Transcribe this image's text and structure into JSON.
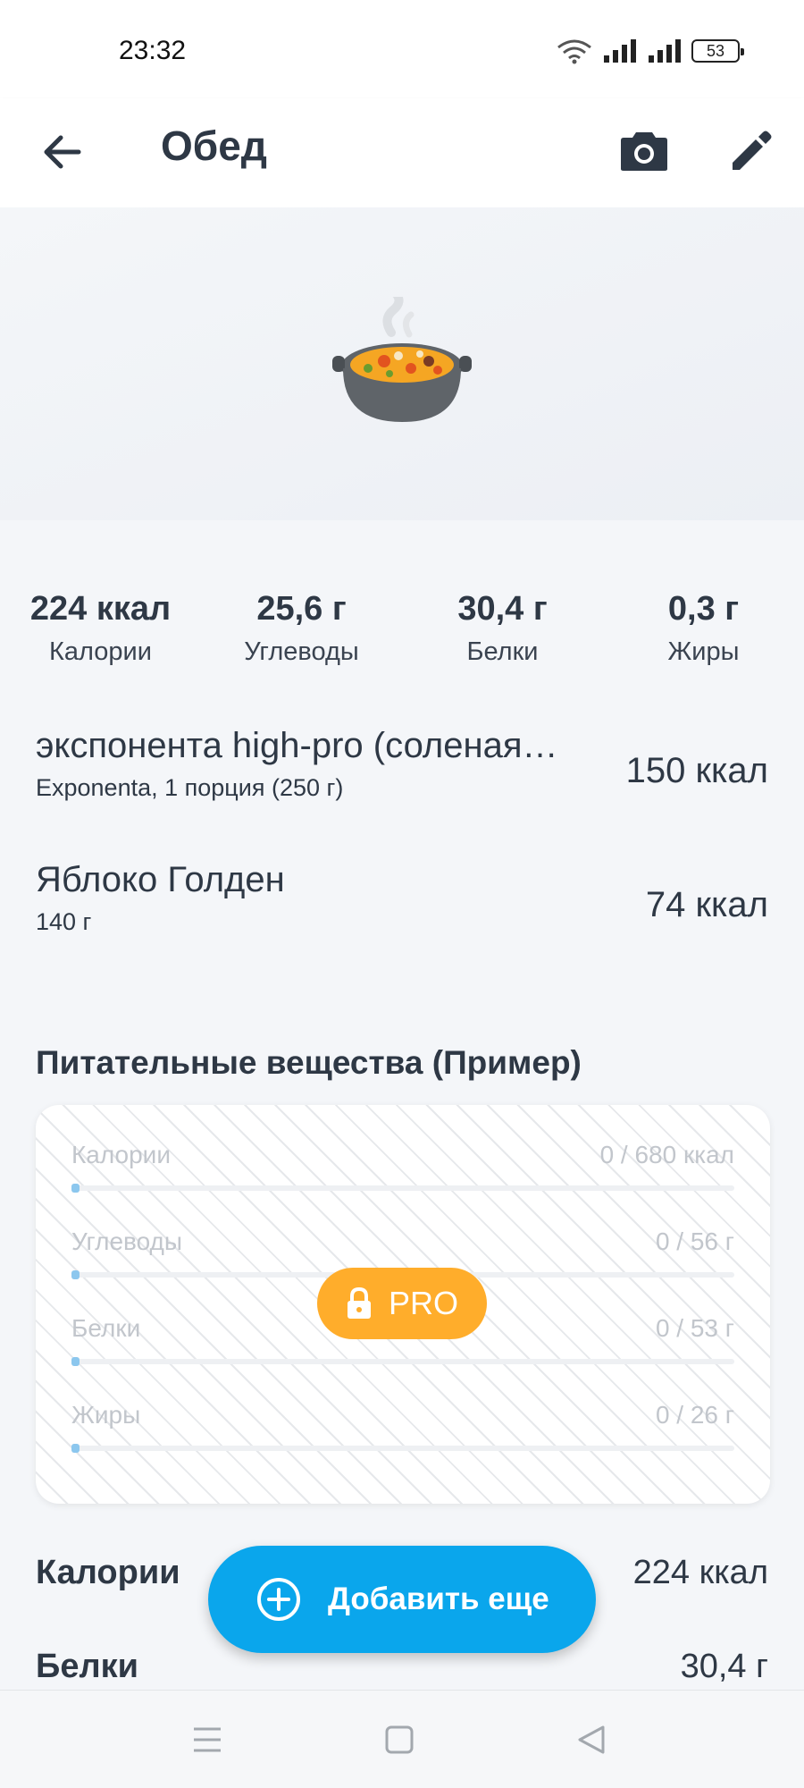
{
  "status_bar": {
    "time": "23:32",
    "battery": "53"
  },
  "app_bar": {
    "title": "Обед"
  },
  "summary": [
    {
      "value": "224 ккал",
      "label": "Калории"
    },
    {
      "value": "25,6 г",
      "label": "Углеводы"
    },
    {
      "value": "30,4 г",
      "label": "Белки"
    },
    {
      "value": "0,3 г",
      "label": "Жиры"
    }
  ],
  "foods": [
    {
      "name": "экспонента high-pro (соленая…",
      "detail": "Exponenta, 1 порция (250 г)",
      "kcal": "150 ккал"
    },
    {
      "name": "Яблоко Голден",
      "detail": "140 г",
      "kcal": "74 ккал"
    }
  ],
  "nutrients": {
    "title": "Питательные вещества (Пример)",
    "rows": [
      {
        "label": "Калории",
        "value": "0 / 680 ккал",
        "progress": 0
      },
      {
        "label": "Углеводы",
        "value": "0 / 56 г",
        "progress": 0
      },
      {
        "label": "Белки",
        "value": "0 / 53 г",
        "progress": 0
      },
      {
        "label": "Жиры",
        "value": "0 / 26 г",
        "progress": 0
      }
    ],
    "pro_label": "PRO",
    "pro_color": "#ffad2b"
  },
  "totals": [
    {
      "label": "Калории",
      "value": "224 ккал"
    },
    {
      "label": "Белки",
      "value": "30,4 г"
    }
  ],
  "fab": {
    "label": "Добавить еще",
    "color": "#0aa6ec"
  },
  "icons": {
    "back": "arrow-left-icon",
    "camera": "camera-icon",
    "edit": "pencil-icon",
    "hero": "cooking-pot-icon",
    "lock": "lock-icon",
    "add": "plus-circle-icon"
  }
}
